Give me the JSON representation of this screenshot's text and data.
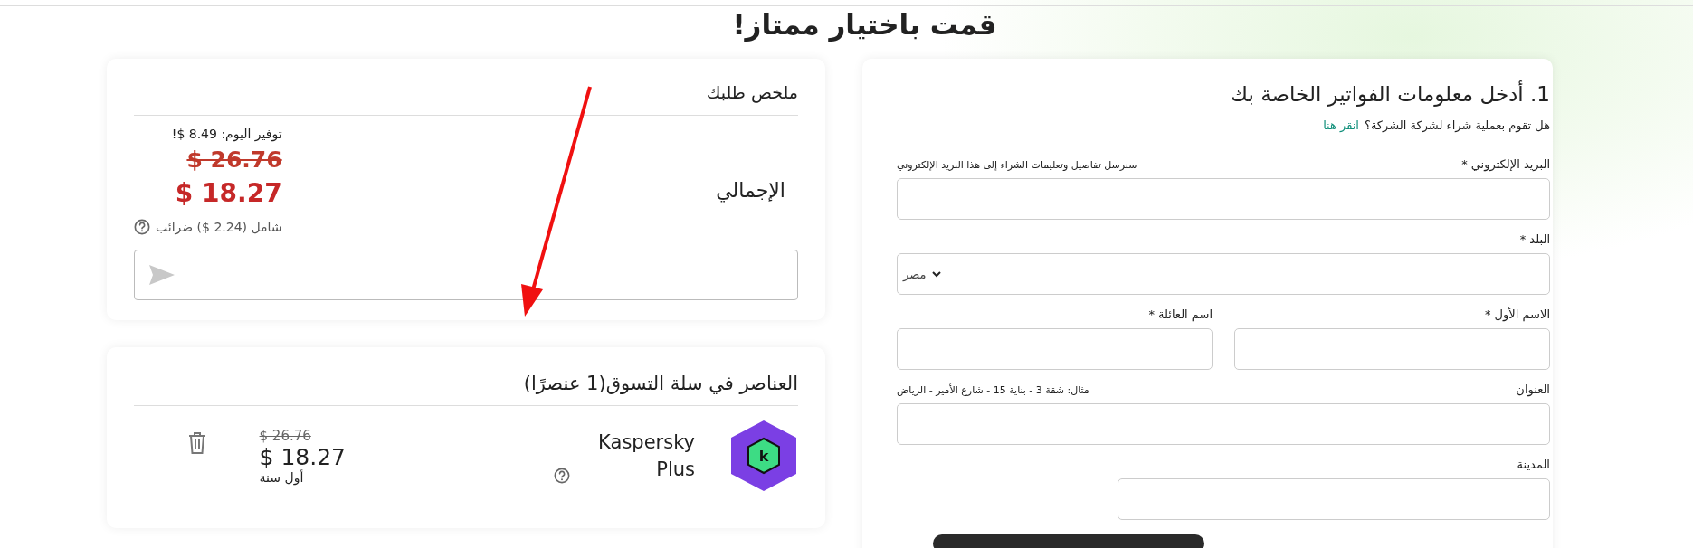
{
  "page_title": "قمت باختيار ممتاز!",
  "billing": {
    "title": "1. أدخل معلومات الفواتير الخاصة بك",
    "company_question": "هل تقوم بعملية شراء لشركة الشركة؟",
    "company_link": "انقر هنا",
    "rows": [
      {
        "fields": [
          {
            "kind": "text",
            "label": "البريد الإلكتروني *",
            "hint": "سنرسل تفاصيل وتعليمات الشراء إلى هذا البريد الإلكتروني"
          }
        ]
      },
      {
        "fields": [
          {
            "kind": "select",
            "label": "البلد *",
            "value": "مصر"
          }
        ]
      },
      {
        "fields": [
          {
            "kind": "text",
            "label": "الاسم الأول *"
          },
          {
            "kind": "text",
            "label": "اسم العائلة *"
          }
        ]
      },
      {
        "fields": [
          {
            "kind": "text",
            "label": "العنوان",
            "hint": "مثال: شقة 3 - بناية 15 - شارع الأمير - الرياض"
          }
        ]
      },
      {
        "fields": [
          {
            "kind": "short",
            "label": "المدينة"
          }
        ]
      }
    ]
  },
  "order_summary": {
    "title": "ملخص طلبك",
    "total_label": "الإجمالي",
    "savings": "توفير اليوم: 8.49 $!",
    "old_price": "$ 26.76",
    "price": "$ 18.27",
    "tax_note": "شامل (2.24 $) ضرائب"
  },
  "cart": {
    "title": "العناصر في سلة التسوق(1 عنصرًا)",
    "items": [
      {
        "logo_letter": "k",
        "name": "Kaspersky Plus",
        "old_price": "$ 26.76",
        "price": "$ 18.27",
        "period": "أول سنة"
      }
    ]
  }
}
